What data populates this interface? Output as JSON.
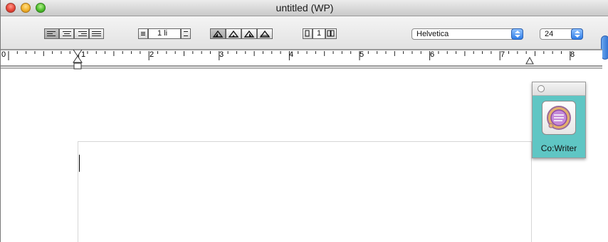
{
  "window": {
    "title": "untitled (WP)"
  },
  "toolbar": {
    "alignment_buttons": [
      "align-left",
      "align-center",
      "align-right",
      "justify"
    ],
    "line_spacing_value": "1 li",
    "tab_buttons": [
      "left-tab",
      "center-tab",
      "right-tab",
      "decimal-tab"
    ],
    "columns_value": "1",
    "font_name": "Helvetica",
    "font_size": "24"
  },
  "ruler": {
    "units": "inches",
    "labels": [
      "0",
      "1",
      "2",
      "3",
      "4",
      "5",
      "6",
      "7",
      "8"
    ]
  },
  "palette": {
    "label": "Co:Writer",
    "icon": "co-writer-icon"
  }
}
